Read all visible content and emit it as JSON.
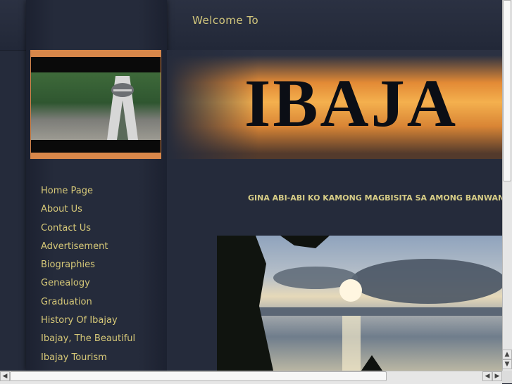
{
  "header": {
    "welcome": "Welcome To"
  },
  "banner": {
    "title": "IBAJA"
  },
  "tagline": "GINA ABI-ABI KO KAMONG MAGBISITA SA AMONG BANWANG IBAJ",
  "nav": [
    "Home Page",
    "About Us",
    "Contact Us",
    "Advertisement",
    "Biographies",
    "Genealogy",
    "Graduation",
    "History Of Ibajay",
    "Ibajay, The Beautiful",
    "Ibajay Tourism"
  ],
  "scrollbars": {
    "up_icon": "arrow-up-icon",
    "down_icon": "arrow-down-icon",
    "left_icon": "arrow-left-icon",
    "right_icon": "arrow-right-icon"
  },
  "colors": {
    "nav_link": "#d6c878",
    "accent_orange": "#d8874a",
    "background": "#252b3b"
  }
}
